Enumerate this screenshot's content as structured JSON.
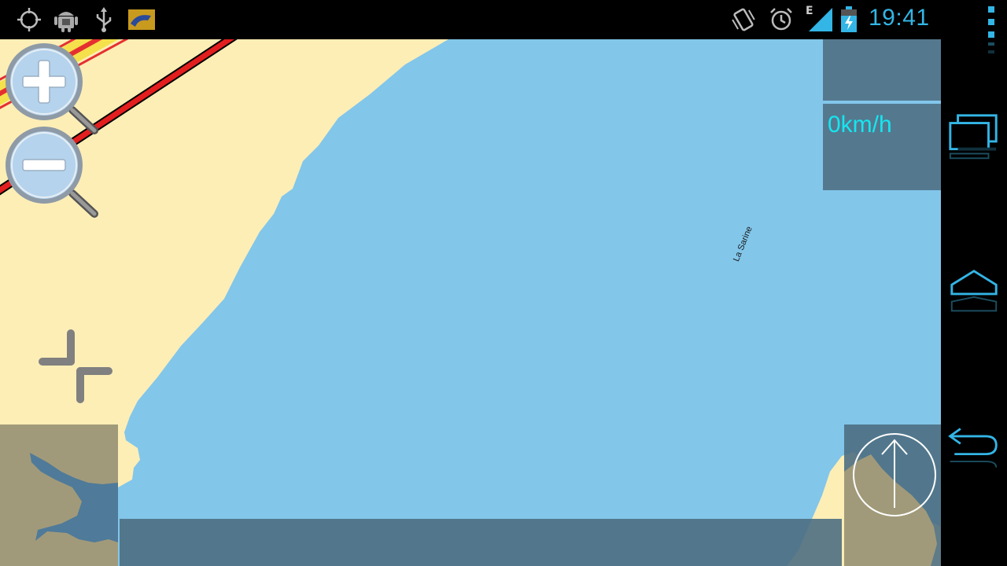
{
  "status_bar": {
    "time": "19:41",
    "network_type": "E",
    "icons_left": [
      "gps-icon",
      "android-debug-icon",
      "usb-icon",
      "app-notification-icon"
    ],
    "icons_right": [
      "vibrate-icon",
      "alarm-icon",
      "signal-icon",
      "battery-charging-icon"
    ]
  },
  "map": {
    "river_label": "La Sarine",
    "speed": "0km/h",
    "water_color": "#82c6ea",
    "land_color": "#fdeeb6"
  },
  "navigation": {
    "buttons": [
      "overflow-menu",
      "recent-apps",
      "home",
      "back"
    ]
  },
  "colors": {
    "accent": "#33b5e5",
    "speed_text": "#16e6f0",
    "panel": "#4d6e82"
  }
}
